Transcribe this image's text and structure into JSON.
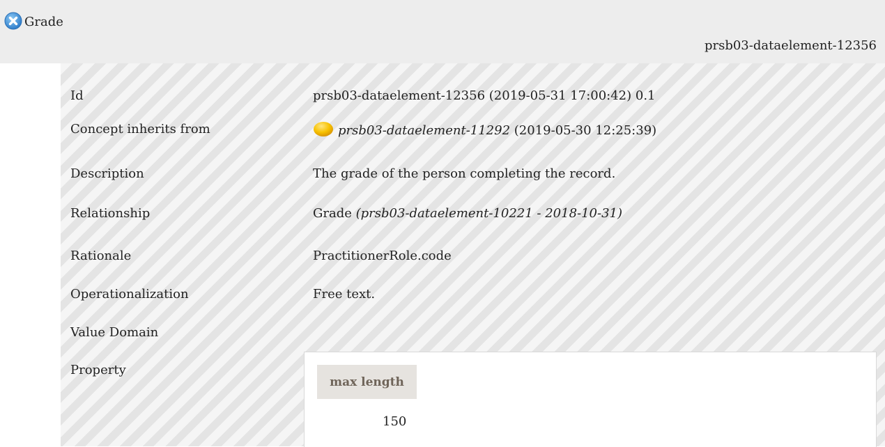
{
  "header": {
    "title": "Grade",
    "id": "prsb03-dataelement-12356"
  },
  "fields": {
    "id": {
      "label": "Id",
      "value": "prsb03-dataelement-12356 (2019-05-31 17:00:42) 0.1"
    },
    "inherits": {
      "label": "Concept inherits from",
      "ref": "prsb03-dataelement-11292",
      "date": "(2019-05-30 12:25:39)"
    },
    "description": {
      "label": "Description",
      "value": "The grade of the person completing the record."
    },
    "relationship": {
      "label": "Relationship",
      "value": "Grade",
      "ref": "(prsb03-dataelement-10221 - 2018-10-31)"
    },
    "rationale": {
      "label": "Rationale",
      "value": "PractitionerRole.code"
    },
    "operationalization": {
      "label": "Operationalization",
      "value": "Free text."
    },
    "value_domain": {
      "label": "Value Domain"
    },
    "property": {
      "label": "Property",
      "header": "max length",
      "value": "150"
    }
  },
  "colors": {
    "close_button": "#3e8fd6",
    "status_dot": "#f5b800",
    "property_header_bg": "#e6e3df",
    "property_header_text": "#6f6459"
  },
  "icons": {
    "close": "close-icon",
    "status": "status-dot-icon"
  }
}
